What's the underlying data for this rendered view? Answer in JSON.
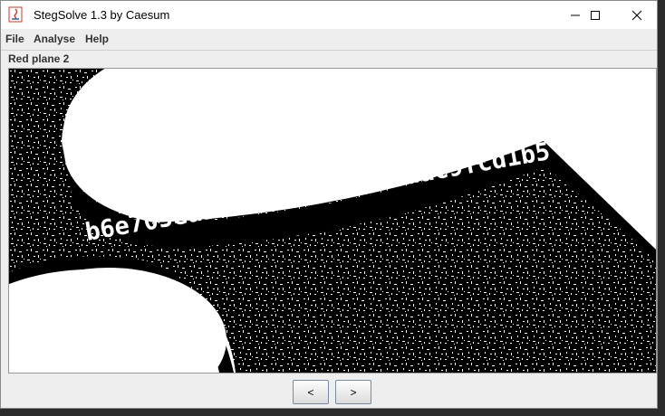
{
  "window": {
    "title": "StegSolve 1.3 by Caesum",
    "controls": {
      "minimize": "minimize-icon",
      "maximize": "maximize-icon",
      "close": "close-icon"
    }
  },
  "menu": {
    "items": [
      "File",
      "Analyse",
      "Help"
    ]
  },
  "viewer": {
    "plane_label": "Red plane 2",
    "hidden_text": "b6e705ea1249e2bb7b0fd7dac9fcd1b5"
  },
  "nav": {
    "prev_label": "<",
    "next_label": ">"
  },
  "colors": {
    "noise_black": "#000000",
    "noise_white": "#ffffff",
    "window_bg": "#eeeeee"
  }
}
